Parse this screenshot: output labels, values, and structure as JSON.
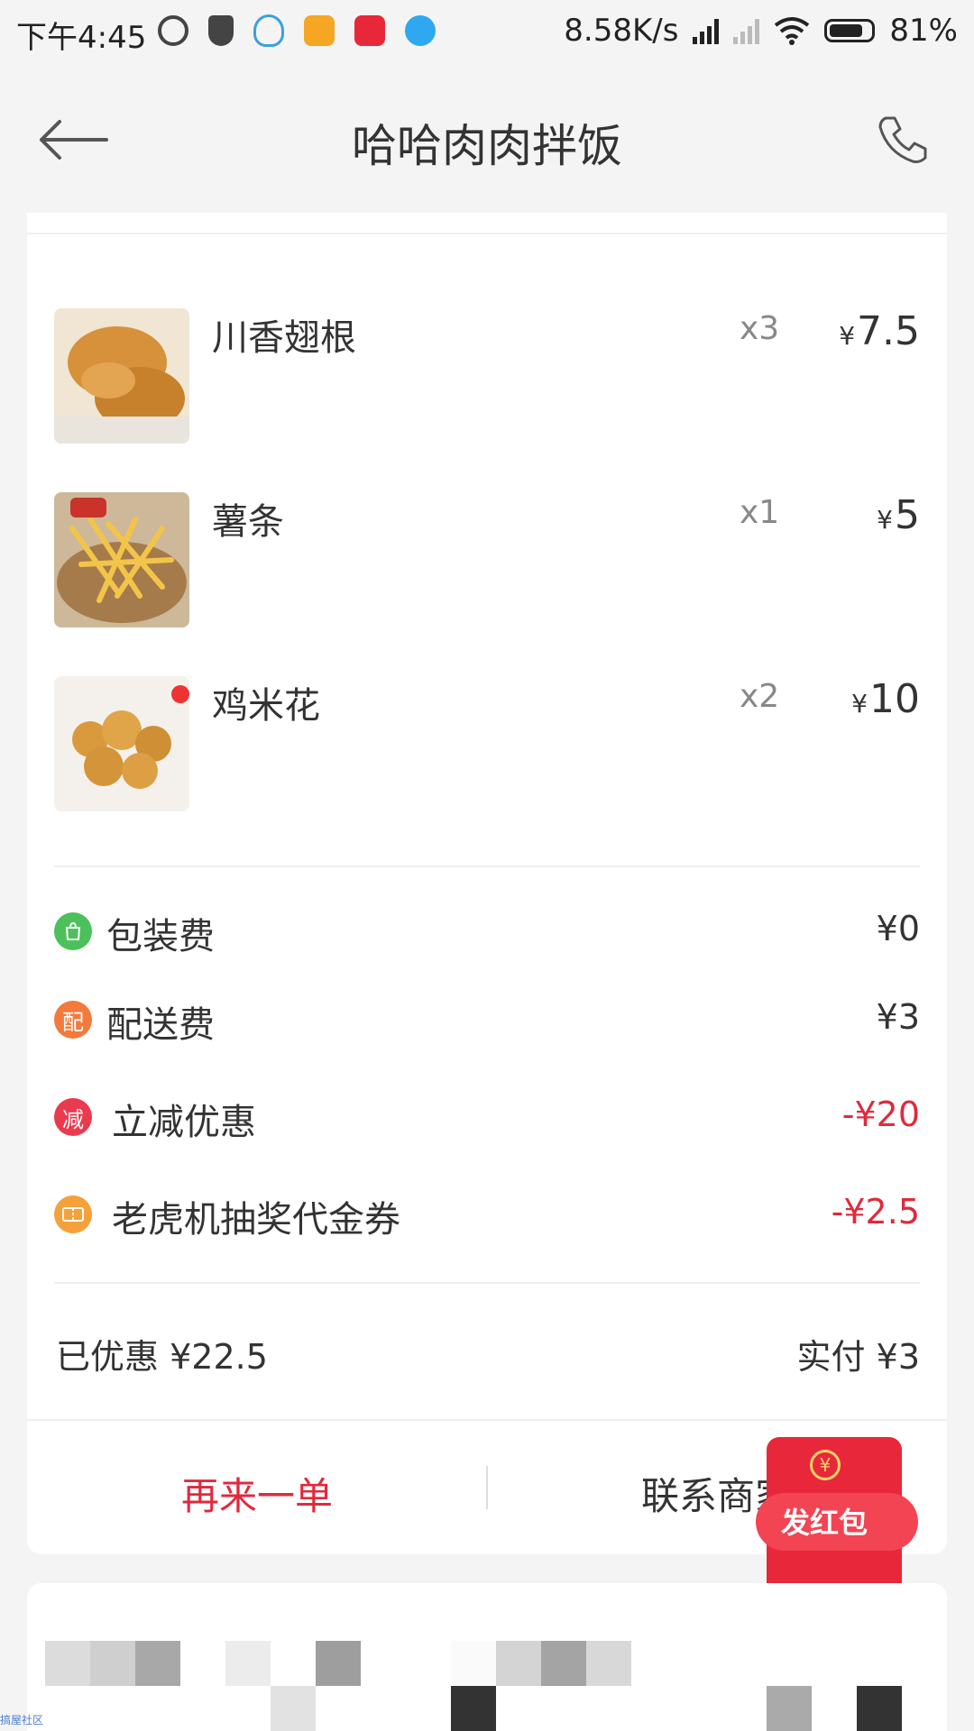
{
  "status_bar": {
    "time": "下午4:45",
    "network_speed": "8.58K/s",
    "battery": "81%",
    "icons": [
      "netease-music-icon",
      "shield-icon",
      "qq-icon",
      "app-icon",
      "star-app-icon",
      "bird-app-icon",
      "signal-hd-icon",
      "signal-icon",
      "wifi-icon",
      "battery-icon"
    ]
  },
  "header": {
    "title": "哈哈肉肉拌饭"
  },
  "items": [
    {
      "name": "川香翅根",
      "qty": "x3",
      "currency": "¥",
      "price": "7.5"
    },
    {
      "name": "薯条",
      "qty": "x1",
      "currency": "¥",
      "price": "5"
    },
    {
      "name": "鸡米花",
      "qty": "x2",
      "currency": "¥",
      "price": "10"
    }
  ],
  "fees": [
    {
      "icon_text": "",
      "icon": "bag-icon",
      "label": "包装费",
      "value": "¥0",
      "color": "#4cc05a"
    },
    {
      "icon_text": "配",
      "icon": "delivery-icon",
      "label": "配送费",
      "value": "¥3",
      "color": "#f27a3a"
    },
    {
      "icon_text": "减",
      "icon": "discount-icon",
      "label": "立减优惠",
      "value": "-¥20",
      "color": "#ea3a4e"
    },
    {
      "icon_text": "",
      "icon": "coupon-icon",
      "label": "老虎机抽奖代金券",
      "value": "-¥2.5",
      "color": "#f6a03a"
    }
  ],
  "summary": {
    "discount_label": "已优惠",
    "discount_value": "¥22.5",
    "paid_label": "实付",
    "paid_value": "¥3"
  },
  "actions": {
    "reorder": "再来一单",
    "contact": "联系商家"
  },
  "red_packet": {
    "label": "发红包",
    "coin": "¥"
  },
  "watermark": "搞屋社区",
  "colors": {
    "accent_red": "#e02a3c",
    "background": "#f4f4f4"
  }
}
